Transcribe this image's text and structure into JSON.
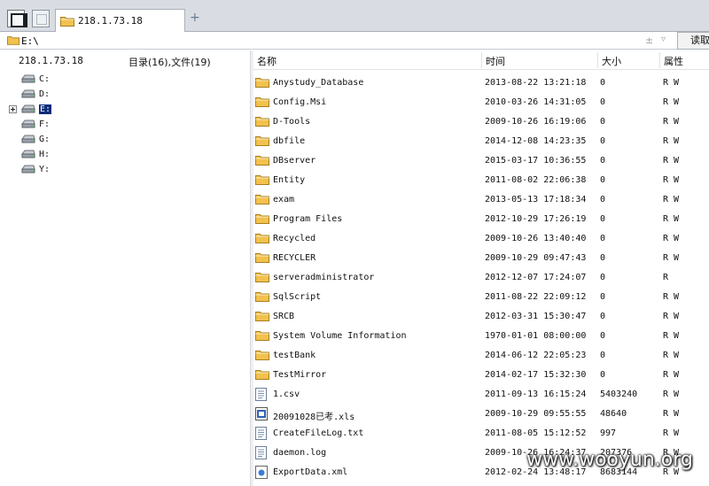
{
  "tab": {
    "title": "218.1.73.18",
    "add_label": "+"
  },
  "address": {
    "value": "E:\\",
    "add_symbol": "±",
    "dropdown_symbol": "▿",
    "read_label": "读取"
  },
  "left_pane": {
    "host": "218.1.73.18",
    "stats": "目录(16),文件(19)",
    "drives": [
      {
        "label": "C:",
        "selected": false
      },
      {
        "label": "D:",
        "selected": false
      },
      {
        "label": "E:",
        "selected": true
      },
      {
        "label": "F:",
        "selected": false
      },
      {
        "label": "G:",
        "selected": false
      },
      {
        "label": "H:",
        "selected": false
      },
      {
        "label": "Y:",
        "selected": false
      }
    ]
  },
  "columns": {
    "name": "名称",
    "time": "时间",
    "size": "大小",
    "attr": "属性"
  },
  "files": [
    {
      "type": "folder",
      "name": "Anystudy_Database",
      "time": "2013-08-22 13:21:18",
      "size": "0",
      "attr": "R W"
    },
    {
      "type": "folder",
      "name": "Config.Msi",
      "time": "2010-03-26 14:31:05",
      "size": "0",
      "attr": "R W"
    },
    {
      "type": "folder",
      "name": "D-Tools",
      "time": "2009-10-26 16:19:06",
      "size": "0",
      "attr": "R W"
    },
    {
      "type": "folder",
      "name": "dbfile",
      "time": "2014-12-08 14:23:35",
      "size": "0",
      "attr": "R W"
    },
    {
      "type": "folder",
      "name": "DBserver",
      "time": "2015-03-17 10:36:55",
      "size": "0",
      "attr": "R W"
    },
    {
      "type": "folder",
      "name": "Entity",
      "time": "2011-08-02 22:06:38",
      "size": "0",
      "attr": "R W"
    },
    {
      "type": "folder",
      "name": "exam",
      "time": "2013-05-13 17:18:34",
      "size": "0",
      "attr": "R W"
    },
    {
      "type": "folder",
      "name": "Program Files",
      "time": "2012-10-29 17:26:19",
      "size": "0",
      "attr": "R W"
    },
    {
      "type": "folder",
      "name": "Recycled",
      "time": "2009-10-26 13:40:40",
      "size": "0",
      "attr": "R W"
    },
    {
      "type": "folder",
      "name": "RECYCLER",
      "time": "2009-10-29 09:47:43",
      "size": "0",
      "attr": "R W"
    },
    {
      "type": "folder",
      "name": "serveradministrator",
      "time": "2012-12-07 17:24:07",
      "size": "0",
      "attr": "R"
    },
    {
      "type": "folder",
      "name": "SqlScript",
      "time": "2011-08-22 22:09:12",
      "size": "0",
      "attr": "R W"
    },
    {
      "type": "folder",
      "name": "SRCB",
      "time": "2012-03-31 15:30:47",
      "size": "0",
      "attr": "R W"
    },
    {
      "type": "folder",
      "name": "System Volume Information",
      "time": "1970-01-01 08:00:00",
      "size": "0",
      "attr": "R W"
    },
    {
      "type": "folder",
      "name": "testBank",
      "time": "2014-06-12 22:05:23",
      "size": "0",
      "attr": "R W"
    },
    {
      "type": "folder",
      "name": "TestMirror",
      "time": "2014-02-17 15:32:30",
      "size": "0",
      "attr": "R W"
    },
    {
      "type": "text",
      "name": "1.csv",
      "time": "2011-09-13 16:15:24",
      "size": "5403240",
      "attr": "R W"
    },
    {
      "type": "excel",
      "name": "20091028已考.xls",
      "time": "2009-10-29 09:55:55",
      "size": "48640",
      "attr": "R W"
    },
    {
      "type": "text",
      "name": "CreateFileLog.txt",
      "time": "2011-08-05 15:12:52",
      "size": "997",
      "attr": "R W"
    },
    {
      "type": "doc",
      "name": "daemon.log",
      "time": "2009-10-26 16:24:37",
      "size": "207376",
      "attr": "R W"
    },
    {
      "type": "web",
      "name": "ExportData.xml",
      "time": "2012-02-24 13:48:17",
      "size": "8683144",
      "attr": "R W"
    }
  ],
  "watermark": "www.wooyun.org",
  "colors": {
    "folder": "#f2c14e",
    "selection": "#0a2b78",
    "tabbar": "#d9dde3"
  }
}
